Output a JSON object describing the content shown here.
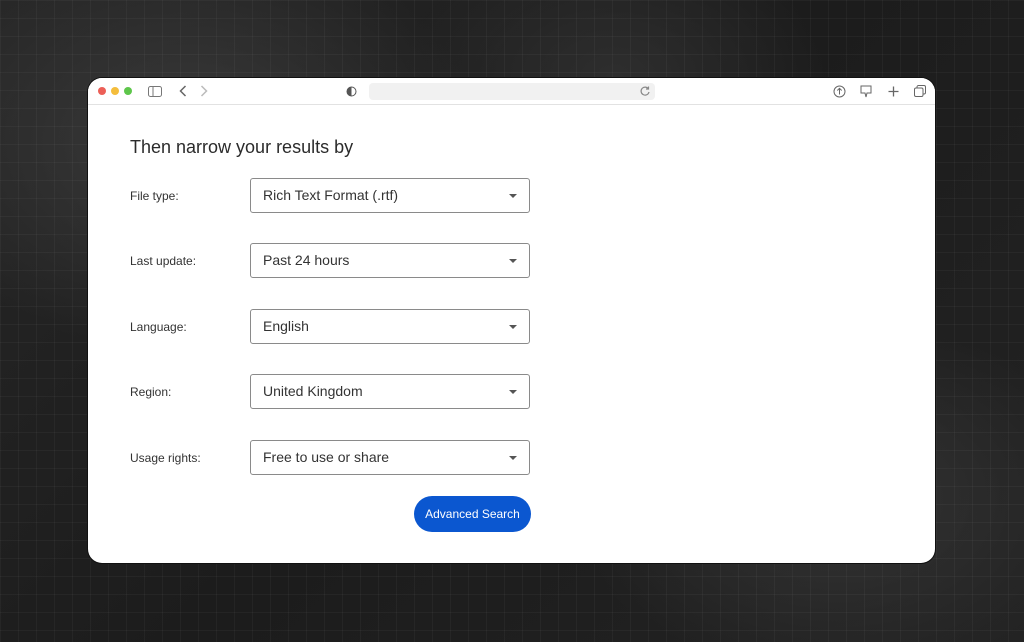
{
  "browser": {
    "address_text": ""
  },
  "page": {
    "heading": "Then narrow your results by"
  },
  "filters": [
    {
      "label": "File type:",
      "value": "Rich Text Format (.rtf)"
    },
    {
      "label": "Last update:",
      "value": "Past 24 hours"
    },
    {
      "label": "Language:",
      "value": "English"
    },
    {
      "label": "Region:",
      "value": "United Kingdom"
    },
    {
      "label": "Usage rights:",
      "value": "Free to use or share"
    }
  ],
  "actions": {
    "advanced_search_label": "Advanced Search"
  },
  "colors": {
    "accent": "#0b57d0",
    "traffic_red": "#ec5f57",
    "traffic_yellow": "#f4bd3c",
    "traffic_green": "#5ec64b"
  },
  "icons": [
    "sidebar-icon",
    "back-icon",
    "forward-icon",
    "privacy-icon",
    "reload-icon",
    "share-icon",
    "download-icon",
    "new-tab-icon",
    "tabs-overview-icon"
  ]
}
